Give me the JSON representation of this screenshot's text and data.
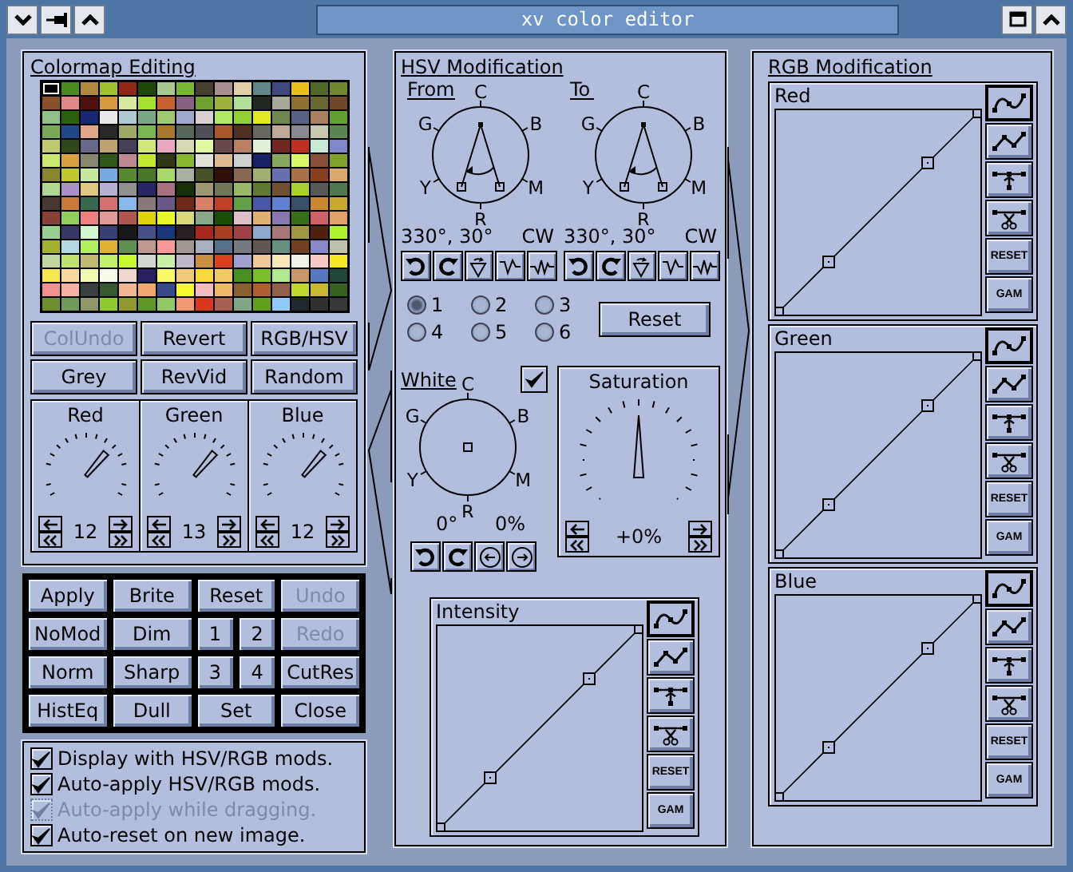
{
  "window": {
    "title": "xv color editor"
  },
  "colormap": {
    "title": "Colormap Editing",
    "rows": [
      [
        {
          "color": "#000000",
          "selected": true
        },
        {
          "color": "#4a8a20",
          "selected": false
        },
        {
          "color": "#b08840",
          "selected": false
        },
        {
          "color": "#a0c030",
          "selected": false
        },
        {
          "color": "#902818",
          "selected": false
        },
        {
          "color": "#204808",
          "selected": false
        },
        {
          "color": "#a8c890",
          "selected": false
        },
        {
          "color": "#78b830",
          "selected": false
        },
        {
          "color": "#484030",
          "selected": false
        },
        {
          "color": "#a89090",
          "selected": false
        },
        {
          "color": "#e0d0a8",
          "selected": false
        },
        {
          "color": "#608888",
          "selected": false
        },
        {
          "color": "#404880",
          "selected": false
        },
        {
          "color": "#e8c020",
          "selected": false
        },
        {
          "color": "#506828",
          "selected": false
        },
        {
          "color": "#708830",
          "selected": false
        }
      ],
      [
        {
          "color": "#8a5028",
          "selected": false
        },
        {
          "color": "#e08888",
          "selected": false
        },
        {
          "color": "#501010",
          "selected": false
        },
        {
          "color": "#d89840",
          "selected": false
        },
        {
          "color": "#d8e8a0",
          "selected": false
        },
        {
          "color": "#a8e030",
          "selected": false
        },
        {
          "color": "#c86030",
          "selected": false
        },
        {
          "color": "#886080",
          "selected": false
        },
        {
          "color": "#70a030",
          "selected": false
        },
        {
          "color": "#a0b040",
          "selected": false
        },
        {
          "color": "#b0e098",
          "selected": false
        },
        {
          "color": "#202820",
          "selected": false
        },
        {
          "color": "#a8a898",
          "selected": false
        },
        {
          "color": "#907030",
          "selected": false
        },
        {
          "color": "#686830",
          "selected": false
        },
        {
          "color": "#704828",
          "selected": false
        }
      ],
      [
        {
          "color": "#90c088",
          "selected": false
        },
        {
          "color": "#286010",
          "selected": false
        },
        {
          "color": "#182870",
          "selected": false
        },
        {
          "color": "#e8e8e8",
          "selected": false
        },
        {
          "color": "#b0c8d0",
          "selected": false
        },
        {
          "color": "#78a888",
          "selected": false
        },
        {
          "color": "#a0c870",
          "selected": false
        },
        {
          "color": "#a0a8d0",
          "selected": false
        },
        {
          "color": "#d8d0d0",
          "selected": false
        },
        {
          "color": "#b0e868",
          "selected": false
        },
        {
          "color": "#90d030",
          "selected": false
        },
        {
          "color": "#e0e828",
          "selected": false
        },
        {
          "color": "#708850",
          "selected": false
        },
        {
          "color": "#586088",
          "selected": false
        },
        {
          "color": "#a88060",
          "selected": false
        },
        {
          "color": "#60a030",
          "selected": false
        }
      ],
      [
        {
          "color": "#78a858",
          "selected": false
        },
        {
          "color": "#204888",
          "selected": false
        },
        {
          "color": "#e0a888",
          "selected": false
        },
        {
          "color": "#282828",
          "selected": false
        },
        {
          "color": "#a0a868",
          "selected": false
        },
        {
          "color": "#78b850",
          "selected": false
        },
        {
          "color": "#a87830",
          "selected": false
        },
        {
          "color": "#586858",
          "selected": false
        },
        {
          "color": "#505058",
          "selected": false
        },
        {
          "color": "#a85828",
          "selected": false
        },
        {
          "color": "#503020",
          "selected": false
        },
        {
          "color": "#686860",
          "selected": false
        },
        {
          "color": "#c0a898",
          "selected": false
        },
        {
          "color": "#888890",
          "selected": false
        },
        {
          "color": "#c8c8b0",
          "selected": false
        },
        {
          "color": "#588850",
          "selected": false
        }
      ],
      [
        {
          "color": "#c0c870",
          "selected": false
        },
        {
          "color": "#304818",
          "selected": false
        },
        {
          "color": "#686888",
          "selected": false
        },
        {
          "color": "#c0a070",
          "selected": false
        },
        {
          "color": "#484058",
          "selected": false
        },
        {
          "color": "#d0e878",
          "selected": false
        },
        {
          "color": "#e8a8c0",
          "selected": false
        },
        {
          "color": "#d8d8b0",
          "selected": false
        },
        {
          "color": "#e0f8a0",
          "selected": false
        },
        {
          "color": "#684848",
          "selected": false
        },
        {
          "color": "#b88060",
          "selected": false
        },
        {
          "color": "#e0f0d8",
          "selected": false
        },
        {
          "color": "#702820",
          "selected": false
        },
        {
          "color": "#c03020",
          "selected": false
        },
        {
          "color": "#c8e8d8",
          "selected": false
        },
        {
          "color": "#8088c8",
          "selected": false
        }
      ],
      [
        {
          "color": "#c8e870",
          "selected": false
        },
        {
          "color": "#d8a040",
          "selected": false
        },
        {
          "color": "#888870",
          "selected": false
        },
        {
          "color": "#305818",
          "selected": false
        },
        {
          "color": "#c08890",
          "selected": false
        },
        {
          "color": "#c0e830",
          "selected": false
        },
        {
          "color": "#303818",
          "selected": false
        },
        {
          "color": "#88b830",
          "selected": false
        },
        {
          "color": "#e0e0d8",
          "selected": false
        },
        {
          "color": "#e0b890",
          "selected": false
        },
        {
          "color": "#d0d0d0",
          "selected": false
        },
        {
          "color": "#182068",
          "selected": false
        },
        {
          "color": "#88a860",
          "selected": false
        },
        {
          "color": "#d8f868",
          "selected": false
        },
        {
          "color": "#885038",
          "selected": false
        },
        {
          "color": "#80a030",
          "selected": false
        }
      ],
      [
        {
          "color": "#888830",
          "selected": false
        },
        {
          "color": "#c0c830",
          "selected": false
        },
        {
          "color": "#c8e8a0",
          "selected": false
        },
        {
          "color": "#78a8e0",
          "selected": false
        },
        {
          "color": "#588830",
          "selected": false
        },
        {
          "color": "#487828",
          "selected": false
        },
        {
          "color": "#a8d868",
          "selected": false
        },
        {
          "color": "#a8b0a0",
          "selected": false
        },
        {
          "color": "#485028",
          "selected": false
        },
        {
          "color": "#301008",
          "selected": false
        },
        {
          "color": "#886850",
          "selected": false
        },
        {
          "color": "#a0b070",
          "selected": false
        },
        {
          "color": "#6870b0",
          "selected": false
        },
        {
          "color": "#a87048",
          "selected": false
        },
        {
          "color": "#884020",
          "selected": false
        },
        {
          "color": "#d8a870",
          "selected": false
        }
      ],
      [
        {
          "color": "#b0d890",
          "selected": false
        },
        {
          "color": "#a890c8",
          "selected": false
        },
        {
          "color": "#e0c880",
          "selected": false
        },
        {
          "color": "#b8b0d0",
          "selected": false
        },
        {
          "color": "#909090",
          "selected": false
        },
        {
          "color": "#282868",
          "selected": false
        },
        {
          "color": "#a87080",
          "selected": false
        },
        {
          "color": "#183008",
          "selected": false
        },
        {
          "color": "#a09870",
          "selected": false
        },
        {
          "color": "#707858",
          "selected": false
        },
        {
          "color": "#98b868",
          "selected": false
        },
        {
          "color": "#607830",
          "selected": false
        },
        {
          "color": "#705030",
          "selected": false
        },
        {
          "color": "#a8d030",
          "selected": false
        },
        {
          "color": "#585858",
          "selected": false
        },
        {
          "color": "#507850",
          "selected": false
        }
      ],
      [
        {
          "color": "#483830",
          "selected": false
        },
        {
          "color": "#c87838",
          "selected": false
        },
        {
          "color": "#386850",
          "selected": false
        },
        {
          "color": "#d07070",
          "selected": false
        },
        {
          "color": "#88b8e8",
          "selected": false
        },
        {
          "color": "#887878",
          "selected": false
        },
        {
          "color": "#685888",
          "selected": false
        },
        {
          "color": "#702818",
          "selected": false
        },
        {
          "color": "#d88068",
          "selected": false
        },
        {
          "color": "#c04028",
          "selected": false
        },
        {
          "color": "#60a048",
          "selected": false
        },
        {
          "color": "#4858a8",
          "selected": false
        },
        {
          "color": "#6080d0",
          "selected": false
        },
        {
          "color": "#385068",
          "selected": false
        },
        {
          "color": "#c88830",
          "selected": false
        },
        {
          "color": "#c8a830",
          "selected": false
        }
      ],
      [
        {
          "color": "#884038",
          "selected": false
        },
        {
          "color": "#90d058",
          "selected": false
        },
        {
          "color": "#f08080",
          "selected": false
        },
        {
          "color": "#e09898",
          "selected": false
        },
        {
          "color": "#b05850",
          "selected": false
        },
        {
          "color": "#e0d010",
          "selected": false
        },
        {
          "color": "#e8f828",
          "selected": false
        },
        {
          "color": "#d8d878",
          "selected": false
        },
        {
          "color": "#88a888",
          "selected": false
        },
        {
          "color": "#185008",
          "selected": false
        },
        {
          "color": "#e0c0c8",
          "selected": false
        },
        {
          "color": "#e0b070",
          "selected": false
        },
        {
          "color": "#8878b0",
          "selected": false
        },
        {
          "color": "#387018",
          "selected": false
        },
        {
          "color": "#d06068",
          "selected": false
        },
        {
          "color": "#e0a068",
          "selected": false
        }
      ],
      [
        {
          "color": "#98d090",
          "selected": false
        },
        {
          "color": "#383868",
          "selected": false
        },
        {
          "color": "#d0f8d0",
          "selected": false
        },
        {
          "color": "#384070",
          "selected": false
        },
        {
          "color": "#181818",
          "selected": false
        },
        {
          "color": "#485088",
          "selected": false
        },
        {
          "color": "#183878",
          "selected": false
        },
        {
          "color": "#282020",
          "selected": false
        },
        {
          "color": "#a82820",
          "selected": false
        },
        {
          "color": "#a84020",
          "selected": false
        },
        {
          "color": "#a04048",
          "selected": false
        },
        {
          "color": "#90a8d0",
          "selected": false
        },
        {
          "color": "#a87878",
          "selected": false
        },
        {
          "color": "#a09840",
          "selected": false
        },
        {
          "color": "#502010",
          "selected": false
        },
        {
          "color": "#b0f030",
          "selected": false
        }
      ],
      [
        {
          "color": "#a0b030",
          "selected": false
        },
        {
          "color": "#b0d8e0",
          "selected": false
        },
        {
          "color": "#b0f060",
          "selected": false
        },
        {
          "color": "#e0b030",
          "selected": false
        },
        {
          "color": "#609050",
          "selected": false
        },
        {
          "color": "#c09890",
          "selected": false
        },
        {
          "color": "#f89898",
          "selected": false
        },
        {
          "color": "#a09890",
          "selected": false
        },
        {
          "color": "#a8b0c0",
          "selected": false
        },
        {
          "color": "#587088",
          "selected": false
        },
        {
          "color": "#787880",
          "selected": false
        },
        {
          "color": "#605850",
          "selected": false
        },
        {
          "color": "#689080",
          "selected": false
        },
        {
          "color": "#704020",
          "selected": false
        },
        {
          "color": "#8888c8",
          "selected": false
        },
        {
          "color": "#c0c0b0",
          "selected": false
        }
      ],
      [
        {
          "color": "#c0d8a0",
          "selected": false
        },
        {
          "color": "#c0e070",
          "selected": false
        },
        {
          "color": "#c0b870",
          "selected": false
        },
        {
          "color": "#c0f068",
          "selected": false
        },
        {
          "color": "#c8f830",
          "selected": false
        },
        {
          "color": "#d0d8d0",
          "selected": false
        },
        {
          "color": "#c8f0a8",
          "selected": false
        },
        {
          "color": "#c0b8c8",
          "selected": false
        },
        {
          "color": "#c89040",
          "selected": false
        },
        {
          "color": "#d84020",
          "selected": false
        },
        {
          "color": "#a0a0d0",
          "selected": false
        },
        {
          "color": "#f0c898",
          "selected": false
        },
        {
          "color": "#f8e8b8",
          "selected": false
        },
        {
          "color": "#f0f0e8",
          "selected": false
        },
        {
          "color": "#f8c8c8",
          "selected": false
        },
        {
          "color": "#f8e820",
          "selected": false
        }
      ],
      [
        {
          "color": "#f8e850",
          "selected": false
        },
        {
          "color": "#f8d8a0",
          "selected": false
        },
        {
          "color": "#f0f8b0",
          "selected": false
        },
        {
          "color": "#f8f8e8",
          "selected": false
        },
        {
          "color": "#f0d8d0",
          "selected": false
        },
        {
          "color": "#282060",
          "selected": false
        },
        {
          "color": "#f8f868",
          "selected": false
        },
        {
          "color": "#f0c878",
          "selected": false
        },
        {
          "color": "#f8d838",
          "selected": false
        },
        {
          "color": "#f0c868",
          "selected": false
        },
        {
          "color": "#489020",
          "selected": false
        },
        {
          "color": "#78c028",
          "selected": false
        },
        {
          "color": "#b0e890",
          "selected": false
        },
        {
          "color": "#c89868",
          "selected": false
        },
        {
          "color": "#5878c0",
          "selected": false
        },
        {
          "color": "#204838",
          "selected": false
        }
      ],
      [
        {
          "color": "#f09090",
          "selected": false
        },
        {
          "color": "#f8b0a0",
          "selected": false
        },
        {
          "color": "#384040",
          "selected": false
        },
        {
          "color": "#385830",
          "selected": false
        },
        {
          "color": "#f0b890",
          "selected": false
        },
        {
          "color": "#f0a870",
          "selected": false
        },
        {
          "color": "#384888",
          "selected": false
        },
        {
          "color": "#f8f830",
          "selected": false
        },
        {
          "color": "#f8b8c0",
          "selected": false
        },
        {
          "color": "#f0b868",
          "selected": false
        },
        {
          "color": "#886030",
          "selected": false
        },
        {
          "color": "#b06030",
          "selected": false
        },
        {
          "color": "#906048",
          "selected": false
        },
        {
          "color": "#c0d830",
          "selected": false
        },
        {
          "color": "#c8b830",
          "selected": false
        },
        {
          "color": "#386020",
          "selected": false
        }
      ],
      [
        {
          "color": "#709030",
          "selected": false
        },
        {
          "color": "#709858",
          "selected": false
        },
        {
          "color": "#909868",
          "selected": false
        },
        {
          "color": "#90c830",
          "selected": false
        },
        {
          "color": "#909830",
          "selected": false
        },
        {
          "color": "#609828",
          "selected": false
        },
        {
          "color": "#90c868",
          "selected": false
        },
        {
          "color": "#f09870",
          "selected": false
        },
        {
          "color": "#d83820",
          "selected": false
        },
        {
          "color": "#a86050",
          "selected": false
        },
        {
          "color": "#80a888",
          "selected": false
        },
        {
          "color": "#60a020",
          "selected": false
        },
        {
          "color": "#90c8f8",
          "selected": false
        },
        {
          "color": "#202830",
          "selected": false
        },
        {
          "color": "#303030",
          "selected": false
        },
        {
          "color": "#383838",
          "selected": false
        }
      ]
    ],
    "buttons": [
      {
        "label": "ColUndo",
        "disabled": true
      },
      {
        "label": "Revert",
        "disabled": false
      },
      {
        "label": "RGB/HSV",
        "disabled": false
      },
      {
        "label": "Grey",
        "disabled": false
      },
      {
        "label": "RevVid",
        "disabled": false
      },
      {
        "label": "Random",
        "disabled": false
      }
    ],
    "dials": [
      {
        "label": "Red",
        "value": "12"
      },
      {
        "label": "Green",
        "value": "13"
      },
      {
        "label": "Blue",
        "value": "12"
      }
    ]
  },
  "hsv": {
    "title": "HSV Modification",
    "wheels": [
      {
        "label": "From",
        "kind": "range",
        "letters": [
          "C",
          "G",
          "B",
          "Y",
          "M",
          "R"
        ],
        "angles": "330°, 30°",
        "direction": "CW",
        "tools": [
          {
            "kind": "rotate-left"
          },
          {
            "kind": "rotate-right"
          },
          {
            "kind": "flip"
          },
          {
            "kind": "peak"
          },
          {
            "kind": "zigzag"
          }
        ]
      },
      {
        "label": "To",
        "kind": "range",
        "letters": [
          "C",
          "G",
          "B",
          "Y",
          "M",
          "R"
        ],
        "angles": "330°, 30°",
        "direction": "CW",
        "tools": [
          {
            "kind": "rotate-left"
          },
          {
            "kind": "rotate-right"
          },
          {
            "kind": "flip"
          },
          {
            "kind": "peak"
          },
          {
            "kind": "zigzag"
          }
        ]
      }
    ],
    "presets": [
      {
        "label": "1",
        "selected": true
      },
      {
        "label": "2",
        "selected": false
      },
      {
        "label": "3",
        "selected": false
      },
      {
        "label": "4",
        "selected": false
      },
      {
        "label": "5",
        "selected": false
      },
      {
        "label": "6",
        "selected": false
      }
    ],
    "reset": "Reset",
    "white": {
      "label": "White",
      "checked": true,
      "kind": "point",
      "letters": [
        "C",
        "G",
        "B",
        "Y",
        "M",
        "R"
      ],
      "hue": "0°",
      "saturation": "0%",
      "tools": [
        {
          "kind": "rotate-left"
        },
        {
          "kind": "rotate-right"
        },
        {
          "kind": "circle-left"
        },
        {
          "kind": "circle-right"
        }
      ]
    },
    "saturation": {
      "label": "Saturation",
      "reading": "+0%"
    },
    "intensity": {
      "title": "Intensity",
      "tools": [
        {
          "kind": "spline",
          "selected": true
        },
        {
          "kind": "linear",
          "selected": false
        },
        {
          "kind": "add",
          "selected": false
        },
        {
          "kind": "delete",
          "selected": false
        }
      ],
      "buttons": [
        "RESET",
        "GAM"
      ]
    }
  },
  "rgb": {
    "title": "RGB Modification",
    "graphs": [
      {
        "title": "Red",
        "tools": [
          {
            "kind": "spline",
            "selected": true
          },
          {
            "kind": "linear",
            "selected": false
          },
          {
            "kind": "add",
            "selected": false
          },
          {
            "kind": "delete",
            "selected": false
          }
        ],
        "buttons": [
          "RESET",
          "GAM"
        ]
      },
      {
        "title": "Green",
        "tools": [
          {
            "kind": "spline",
            "selected": true
          },
          {
            "kind": "linear",
            "selected": false
          },
          {
            "kind": "add",
            "selected": false
          },
          {
            "kind": "delete",
            "selected": false
          }
        ],
        "buttons": [
          "RESET",
          "GAM"
        ]
      },
      {
        "title": "Blue",
        "tools": [
          {
            "kind": "spline",
            "selected": true
          },
          {
            "kind": "linear",
            "selected": false
          },
          {
            "kind": "add",
            "selected": false
          },
          {
            "kind": "delete",
            "selected": false
          }
        ],
        "buttons": [
          "RESET",
          "GAM"
        ]
      }
    ]
  },
  "actions": [
    {
      "label": "Apply",
      "kind": "full",
      "disabled": false
    },
    {
      "label": "Brite",
      "kind": "full",
      "disabled": false
    },
    {
      "label": "Reset",
      "kind": "full",
      "disabled": false
    },
    {
      "label": "Undo",
      "kind": "full",
      "disabled": true
    },
    {
      "label": "NoMod",
      "kind": "full",
      "disabled": false
    },
    {
      "label": "Dim",
      "kind": "full",
      "disabled": false
    },
    {
      "label": "1",
      "kind": "half",
      "disabled": false
    },
    {
      "label": "2",
      "kind": "half",
      "disabled": false
    },
    {
      "label": "Redo",
      "kind": "full",
      "disabled": true
    },
    {
      "label": "Norm",
      "kind": "full",
      "disabled": false
    },
    {
      "label": "Sharp",
      "kind": "full",
      "disabled": false
    },
    {
      "label": "3",
      "kind": "half",
      "disabled": false
    },
    {
      "label": "4",
      "kind": "half",
      "disabled": false
    },
    {
      "label": "CutRes",
      "kind": "full",
      "disabled": false
    },
    {
      "label": "HistEq",
      "kind": "full",
      "disabled": false
    },
    {
      "label": "Dull",
      "kind": "full",
      "disabled": false
    },
    {
      "label": "Set",
      "kind": "full",
      "disabled": false
    },
    {
      "label": "Close",
      "kind": "full",
      "disabled": false
    }
  ],
  "options": [
    {
      "label": "Display with HSV/RGB mods.",
      "checked": true,
      "disabled": false
    },
    {
      "label": "Auto-apply HSV/RGB mods.",
      "checked": true,
      "disabled": false
    },
    {
      "label": "Auto-apply while dragging.",
      "checked": true,
      "disabled": true
    },
    {
      "label": "Auto-reset on new image.",
      "checked": true,
      "disabled": false
    }
  ]
}
